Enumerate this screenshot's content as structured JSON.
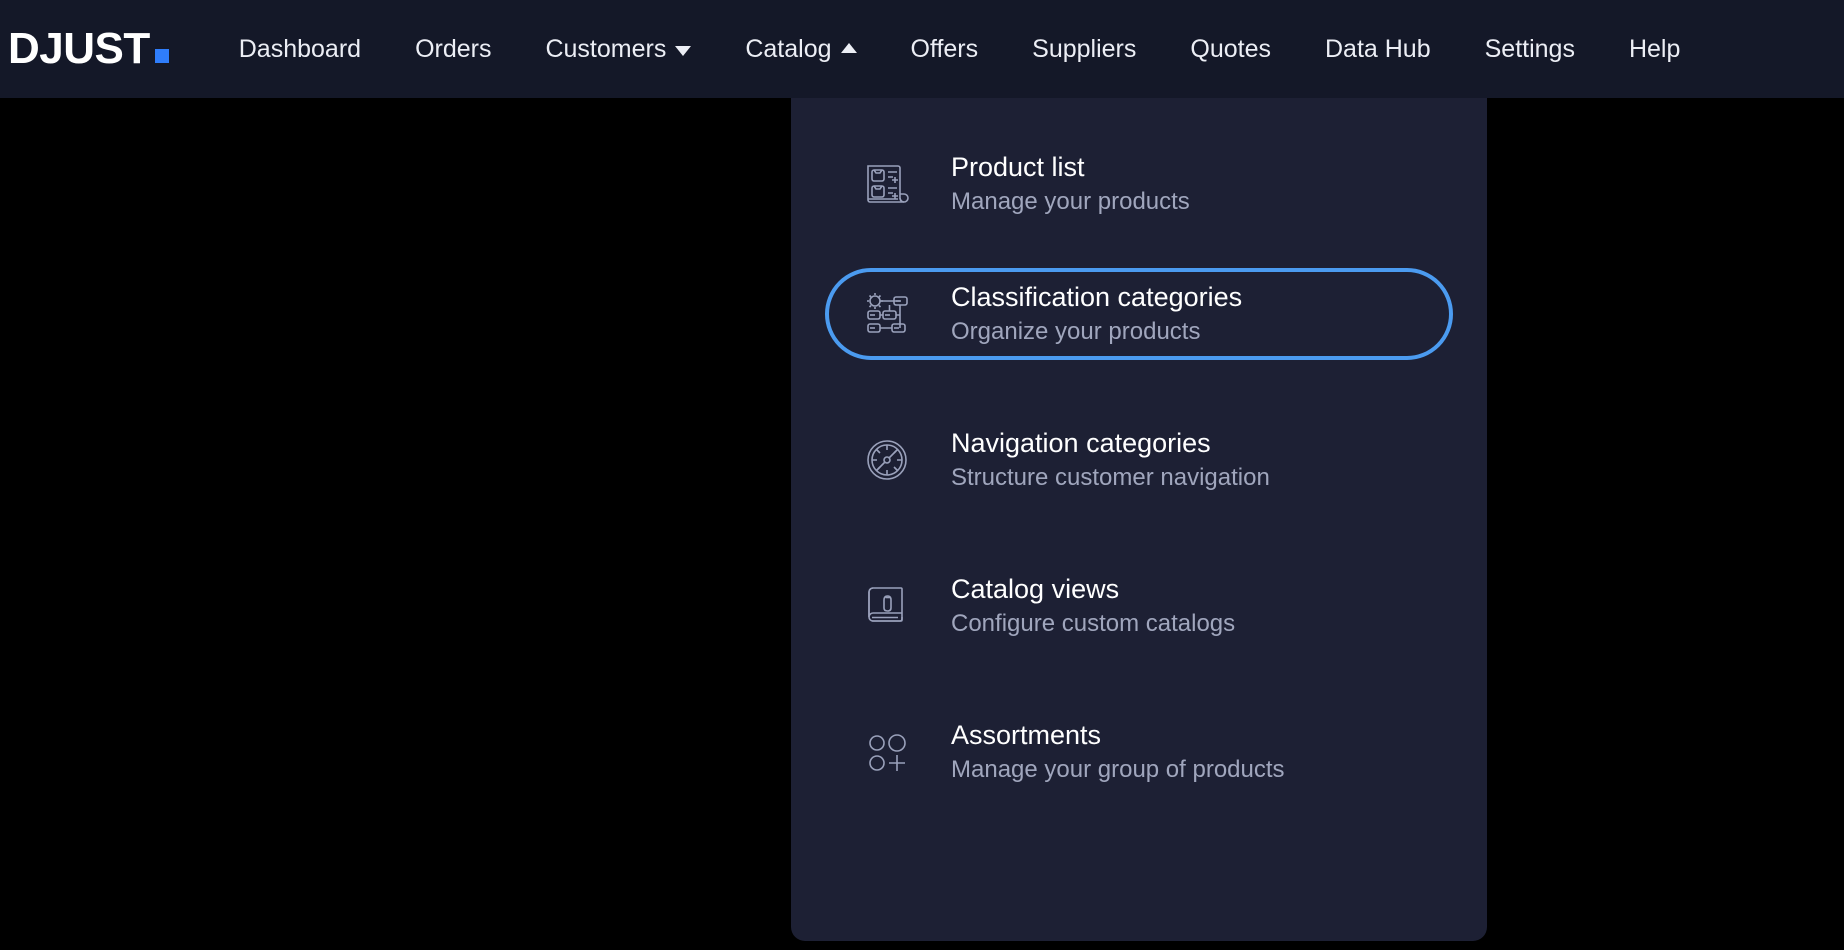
{
  "brand": {
    "name": "DJUST",
    "dot_color": "#2f7dfb"
  },
  "nav": {
    "items": [
      {
        "label": "Dashboard",
        "caret": "none"
      },
      {
        "label": "Orders",
        "caret": "none"
      },
      {
        "label": "Customers",
        "caret": "down"
      },
      {
        "label": "Catalog",
        "caret": "up"
      },
      {
        "label": "Offers",
        "caret": "none"
      },
      {
        "label": "Suppliers",
        "caret": "none"
      },
      {
        "label": "Quotes",
        "caret": "none"
      },
      {
        "label": "Data Hub",
        "caret": "none"
      },
      {
        "label": "Settings",
        "caret": "none"
      },
      {
        "label": "Help",
        "caret": "none"
      }
    ]
  },
  "dropdown": {
    "open_for": "Catalog",
    "highlight_color": "#4b9bf0",
    "items": [
      {
        "title": "Product list",
        "subtitle": "Manage your products",
        "icon": "product-list-icon",
        "highlighted": false
      },
      {
        "title": "Classification categories",
        "subtitle": "Organize your products",
        "icon": "classification-tree-icon",
        "highlighted": true
      },
      {
        "title": "Navigation categories",
        "subtitle": "Structure customer navigation",
        "icon": "compass-icon",
        "highlighted": false
      },
      {
        "title": "Catalog views",
        "subtitle": "Configure custom catalogs",
        "icon": "book-icon",
        "highlighted": false
      },
      {
        "title": "Assortments",
        "subtitle": "Manage your group of products",
        "icon": "circles-plus-icon",
        "highlighted": false
      }
    ]
  }
}
